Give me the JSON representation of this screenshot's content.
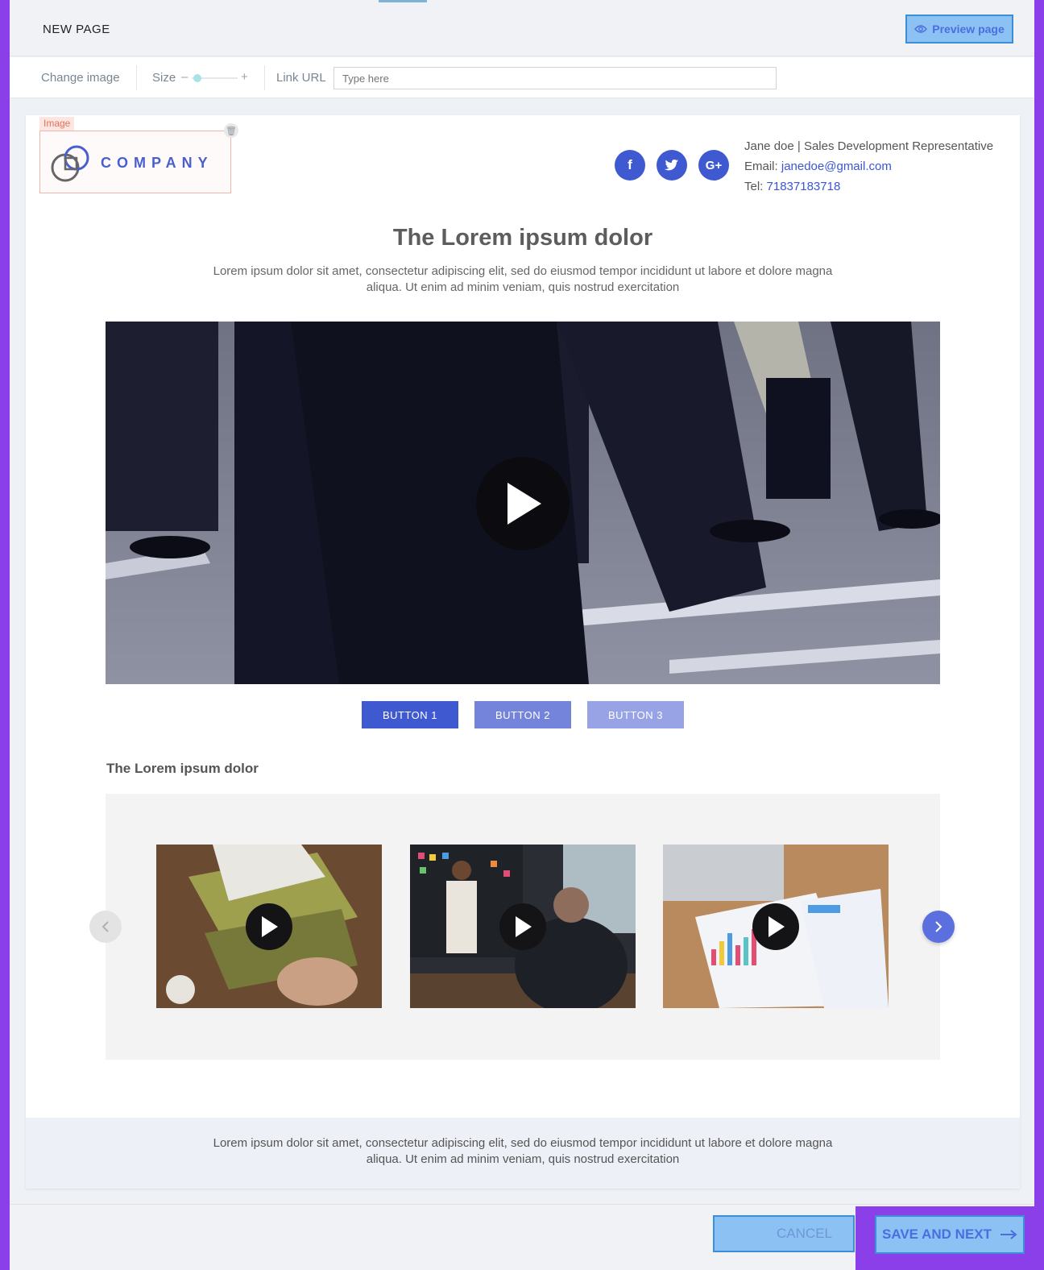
{
  "header": {
    "title": "NEW PAGE",
    "preview_label": "Preview page"
  },
  "toolbar": {
    "change_image": "Change image",
    "size_label": "Size",
    "size_minus": "–",
    "size_plus": "+",
    "size_level": 0.15,
    "link_label": "Link URL",
    "link_placeholder": "Type here",
    "link_value": ""
  },
  "canvas": {
    "image_tag": "Image",
    "logo_text": "COMPANY",
    "social": [
      {
        "icon": "facebook-icon",
        "glyph": "f"
      },
      {
        "icon": "twitter-icon",
        "glyph": "t"
      },
      {
        "icon": "google-plus-icon",
        "glyph": "G+"
      }
    ],
    "contact": {
      "name_line": "Jane doe | Sales Development Representative",
      "email_label": "Email:",
      "email": "janedoe@gmail.com",
      "tel_label": "Tel:",
      "tel": "71837183718"
    },
    "title": "The Lorem ipsum dolor",
    "description": "Lorem ipsum dolor sit amet, consectetur adipiscing elit, sed do eiusmod tempor incididunt ut labore et dolore magna aliqua. Ut enim ad minim veniam, quis nostrud exercitation",
    "buttons": [
      "BUTTON 1",
      "BUTTON 2",
      "BUTTON 3"
    ],
    "section_title": "The Lorem ipsum dolor",
    "thumbnails": [
      "marketing",
      "meeting",
      "analytics"
    ],
    "footer_text": "Lorem ipsum dolor sit amet, consectetur adipiscing elit, sed do eiusmod tempor incididunt ut labore et dolore magna aliqua. Ut enim ad minim veniam, quis nostrud exercitation"
  },
  "bottom": {
    "cancel_label": "CANCEL",
    "save_label": "SAVE AND NEXT"
  },
  "colors": {
    "accent": "#3f59d1",
    "frame": "#8a3fe8",
    "highlight": "#8cc1f4"
  }
}
